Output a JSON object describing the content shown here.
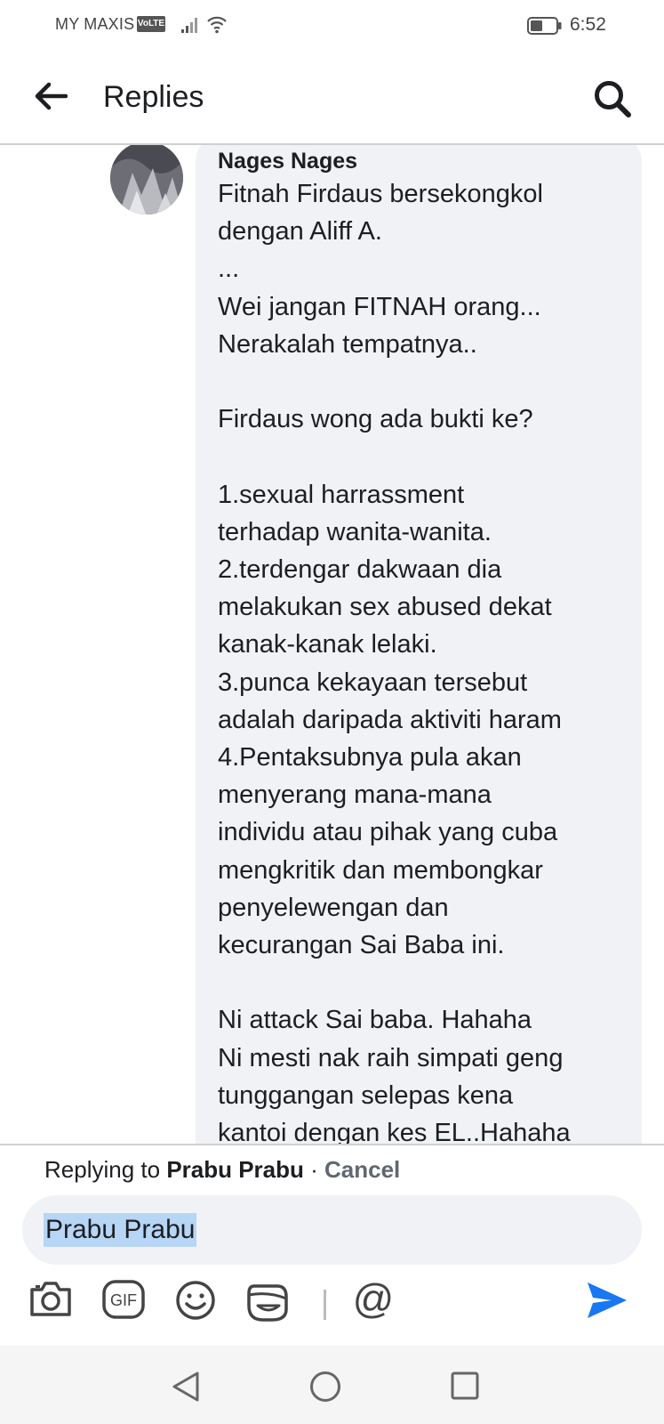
{
  "status_bar": {
    "carrier": "MY MAXIS",
    "volte_badge": "VoLTE",
    "time": "6:52"
  },
  "header": {
    "title": "Replies",
    "back_icon": "arrow-left-icon",
    "search_icon": "search-icon"
  },
  "comment": {
    "author": "Nages Nages",
    "lines": [
      "Fitnah Firdaus bersekongkol",
      "dengan Aliff A.",
      "...",
      "Wei jangan FITNAH orang...",
      "Nerakalah tempatnya..",
      "",
      "Firdaus wong ada bukti ke?",
      "",
      "1.sexual harrassment",
      "terhadap wanita-wanita.",
      "2.terdengar dakwaan dia",
      "melakukan sex abused dekat",
      "kanak-kanak lelaki.",
      "3.punca kekayaan tersebut",
      "adalah daripada aktiviti haram",
      "4.Pentaksubnya pula akan",
      "menyerang mana-mana",
      "individu atau pihak yang cuba",
      "mengkritik dan membongkar",
      "penyelewengan dan",
      "kecurangan Sai Baba ini.",
      "",
      "Ni attack Sai baba. Hahaha",
      "Ni mesti nak raih simpati geng",
      "tunggangan selepas kena",
      "kantoi dengan kes EL..Hahaha"
    ]
  },
  "reply": {
    "replying_prefix": "Replying to ",
    "replying_name": "Prabu Prabu",
    "separator": " · ",
    "cancel_label": "Cancel",
    "input_value": "Prabu Prabu"
  },
  "toolbar": {
    "icons": [
      "camera-icon",
      "gif-icon",
      "emoji-icon",
      "sticker-icon",
      "mention-icon",
      "send-icon"
    ],
    "gif_label": "GIF",
    "mention_label": "@",
    "send_color": "#1877f2"
  },
  "nav": {
    "icons": [
      "nav-back-icon",
      "nav-home-icon",
      "nav-recents-icon"
    ]
  }
}
